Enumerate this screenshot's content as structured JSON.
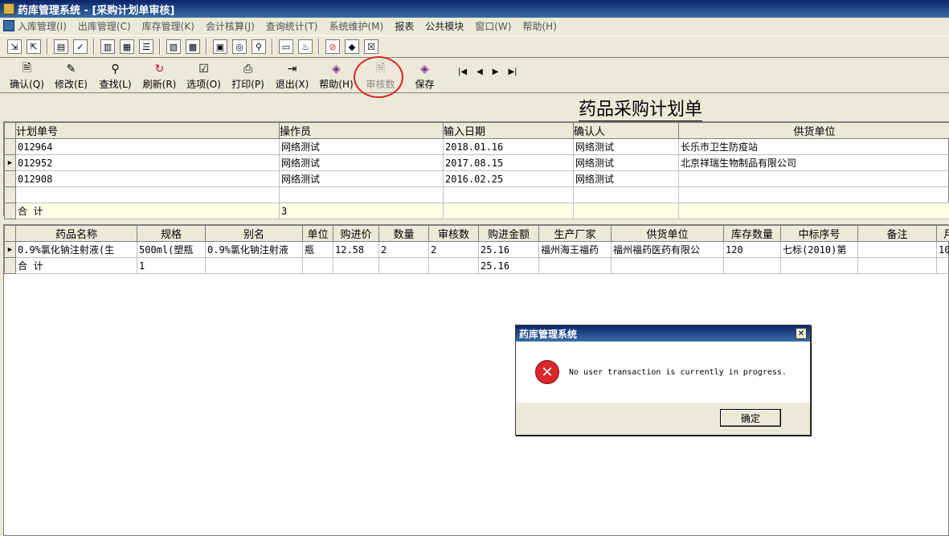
{
  "window": {
    "title": "药库管理系统 - [采购计划单审核]"
  },
  "menubar": {
    "items": [
      "入库管理(I)",
      "出库管理(C)",
      "库存管理(K)",
      "会计核算(J)",
      "查询统计(T)",
      "系统维护(M)",
      "报表",
      "公共模块",
      "窗口(W)",
      "帮助(H)"
    ]
  },
  "toolbar": {
    "buttons": [
      {
        "label": "确认(Q)",
        "icon": "confirm-doc-icon"
      },
      {
        "label": "修改(E)",
        "icon": "edit-doc-icon"
      },
      {
        "label": "查找(L)",
        "icon": "search-icon"
      },
      {
        "label": "刷新(R)",
        "icon": "refresh-icon"
      },
      {
        "label": "选项(O)",
        "icon": "options-icon"
      },
      {
        "label": "打印(P)",
        "icon": "printer-icon"
      },
      {
        "label": "退出(X)",
        "icon": "exit-door-icon"
      },
      {
        "label": "帮助(H)",
        "icon": "help-book-icon"
      },
      {
        "label": "审核数",
        "icon": "audit-doc-icon",
        "disabled": true
      },
      {
        "label": "保存",
        "icon": "save-book-icon"
      }
    ]
  },
  "report": {
    "title": "药品采购计划单"
  },
  "plans": {
    "headers": [
      "计划单号",
      "操作员",
      "输入日期",
      "确认人",
      "供货单位"
    ],
    "rows": [
      [
        "012964",
        "网络测试",
        "2018.01.16",
        "网络测试",
        "长乐市卫生防疫站"
      ],
      [
        "012952",
        "网络测试",
        "2017.08.15",
        "网络测试",
        "北京祥瑞生物制品有限公司"
      ],
      [
        "012908",
        "网络测试",
        "2016.02.25",
        "网络测试",
        ""
      ]
    ],
    "total_label": "合  计",
    "total_count": "3"
  },
  "details": {
    "headers": [
      "药品名称",
      "规格",
      "别名",
      "单位",
      "购进价",
      "数量",
      "审核数",
      "购进金额",
      "生产厂家",
      "供货单位",
      "库存数量",
      "中标序号",
      "备注",
      "月"
    ],
    "rows": [
      [
        "0.9%氯化钠注射液(生",
        "500ml(塑瓶",
        "0.9%氯化钠注射液",
        "瓶",
        "12.58",
        "2",
        "2",
        "25.16",
        "福州海王福药",
        "福州福药医药有限公",
        "120",
        "七标(2010)第",
        "",
        "10"
      ]
    ],
    "total_label": "合  计",
    "total_count": "1",
    "total_amount": "25.16"
  },
  "dialog": {
    "title": "药库管理系统",
    "message": "No user transaction is currently in progress.",
    "ok_label": "确定"
  },
  "colors": {
    "titlebar": "#0a246a",
    "highlight_circle": "#e0212c",
    "error_icon": "#d8262c"
  }
}
